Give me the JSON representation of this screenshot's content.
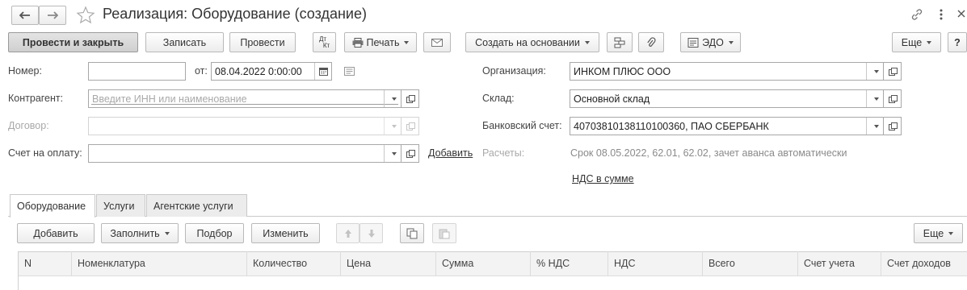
{
  "window": {
    "title": "Реализация: Оборудование (создание)"
  },
  "toolbar": {
    "post_close": "Провести и закрыть",
    "save": "Записать",
    "post": "Провести",
    "dt_kt_top": "Дт",
    "dt_kt_bottom": "Кт",
    "print": "Печать",
    "create_based": "Создать на основании",
    "edo": "ЭДО",
    "more": "Еще",
    "help": "?"
  },
  "form": {
    "number_label": "Номер:",
    "number_value": "",
    "date_label": "от:",
    "date_value": "08.04.2022  0:00:00",
    "counterparty_label": "Контрагент:",
    "counterparty_placeholder": "Введите ИНН или наименование",
    "contract_label": "Договор:",
    "invoice_label": "Счет на оплату:",
    "invoice_add_link": "Добавить",
    "org_label": "Организация:",
    "org_value": "ИНКОМ ПЛЮС ООО",
    "warehouse_label": "Склад:",
    "warehouse_value": "Основной склад",
    "bank_label": "Банковский счет:",
    "bank_value": "40703810138110100360, ПАО СБЕРБАНК",
    "settlements_label": "Расчеты:",
    "settlements_value": "Срок 08.05.2022, 62.01, 62.02, зачет аванса автоматически",
    "vat_link": "НДС в сумме"
  },
  "tabs": [
    {
      "label": "Оборудование",
      "active": true
    },
    {
      "label": "Услуги",
      "active": false
    },
    {
      "label": "Агентские услуги",
      "active": false
    }
  ],
  "table_toolbar": {
    "add": "Добавить",
    "fill": "Заполнить",
    "pick": "Подбор",
    "edit": "Изменить",
    "more": "Еще"
  },
  "table": {
    "columns": [
      "N",
      "Номенклатура",
      "Количество",
      "Цена",
      "Сумма",
      "% НДС",
      "НДС",
      "Всего",
      "Счет учета",
      "Счет доходов"
    ]
  }
}
